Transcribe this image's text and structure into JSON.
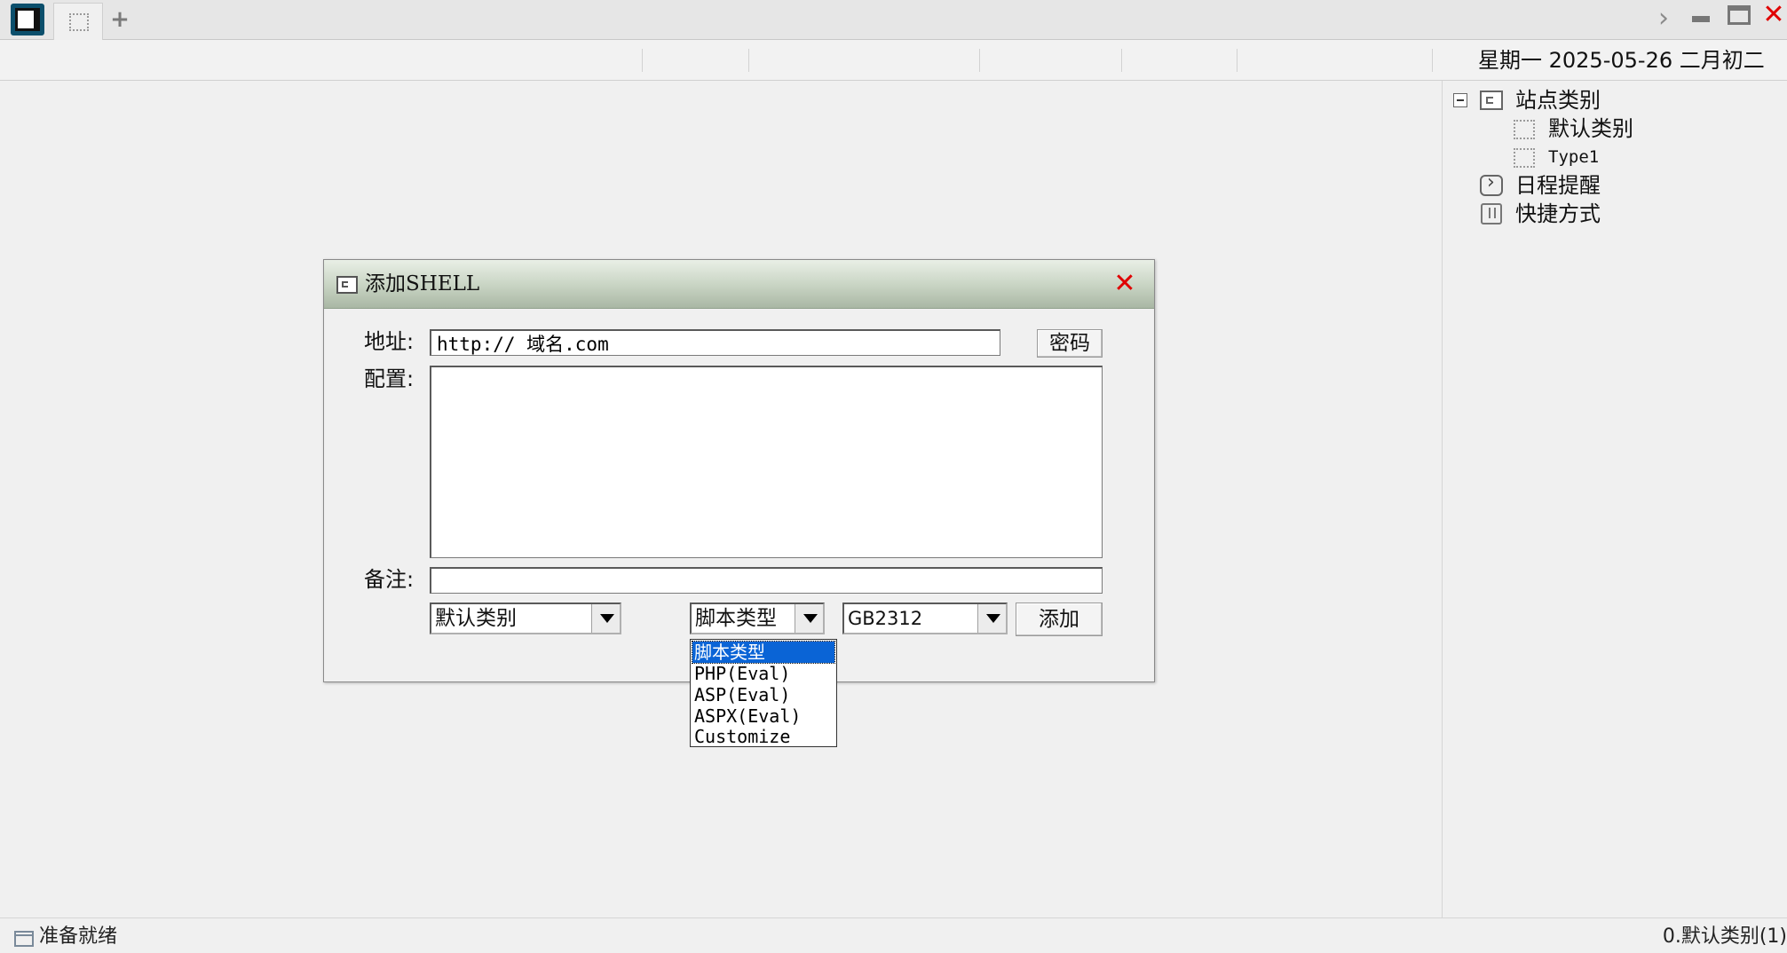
{
  "tabbar": {
    "add_label": "+",
    "next_label": "›",
    "close_label": "✕"
  },
  "infobar": {
    "date_text": "星期一 2025-05-26 二月初二"
  },
  "tree": {
    "items": [
      {
        "label": "站点类别",
        "icon": "folder-icon"
      },
      {
        "label": "默认类别",
        "icon": "dashed-box-icon"
      },
      {
        "label": "Type1",
        "icon": "dashed-box-icon"
      },
      {
        "label": "日程提醒",
        "icon": "clock-icon"
      },
      {
        "label": "快捷方式",
        "icon": "hand-icon"
      }
    ]
  },
  "dialog": {
    "title": "添加SHELL",
    "close_label": "✕",
    "url_label": "地址:",
    "url_value": "http:// 域名.com",
    "password_label": "密码",
    "config_label": "配置:",
    "config_value": "",
    "note_label": "备注:",
    "note_value": "",
    "category_selected": "默认类别",
    "script_selected": "脚本类型",
    "encoding_selected": "GB2312",
    "add_button": "添加"
  },
  "dropdown": {
    "options": [
      "脚本类型",
      "PHP(Eval)",
      "ASP(Eval)",
      "ASPX(Eval)",
      "Customize"
    ],
    "selected_index": 0
  },
  "status": {
    "left_text": "准备就绪",
    "right_text": "0.默认类别(1)"
  },
  "colors": {
    "close_red": "#e00000",
    "selection_blue": "#0a64d6"
  }
}
